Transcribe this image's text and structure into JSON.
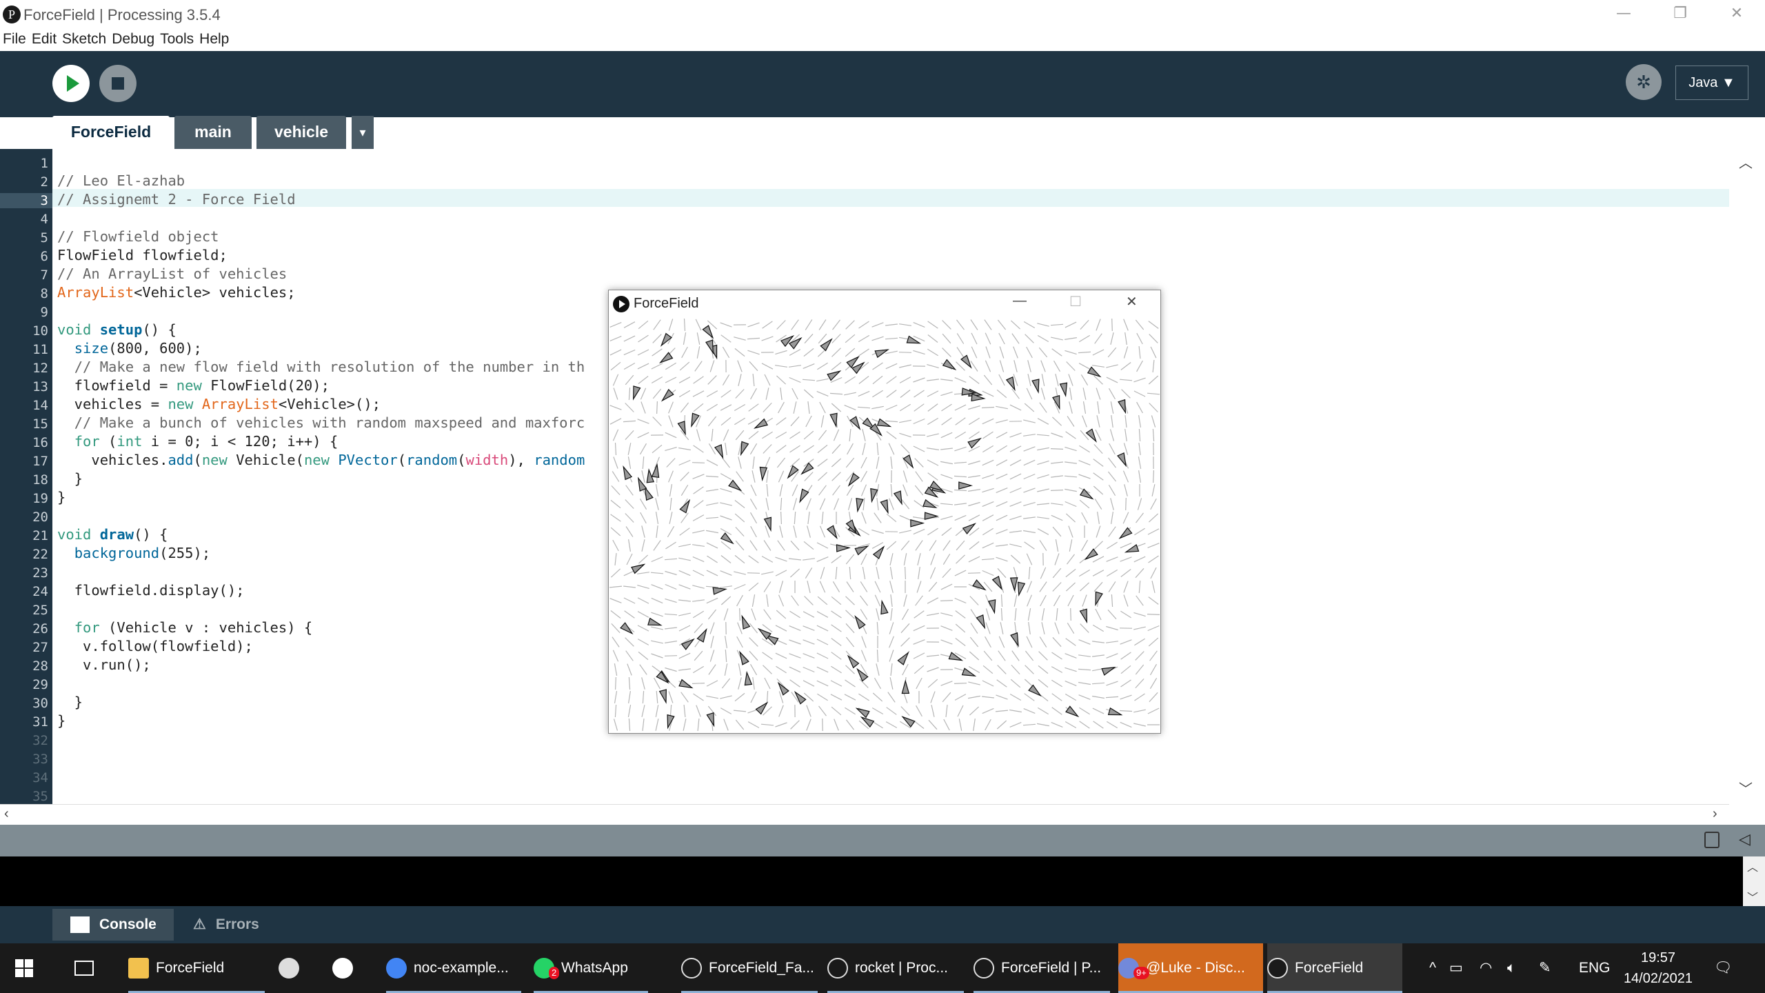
{
  "window": {
    "title": "ForceField | Processing 3.5.4",
    "minimize": "—",
    "restore": "❐",
    "close": "✕"
  },
  "menu": [
    "File",
    "Edit",
    "Sketch",
    "Debug",
    "Tools",
    "Help"
  ],
  "toolbar": {
    "mode": "Java ▼"
  },
  "tabs": [
    "ForceField",
    "main",
    "vehicle"
  ],
  "tabs_more": "▾",
  "editor": {
    "current_line": 3,
    "line_count": 35,
    "lines": [
      "",
      "// Leo El-azhab",
      "// Assignemt 2 - Force Field",
      "",
      "// Flowfield object",
      "FlowField flowfield;",
      "// An ArrayList of vehicles",
      "ArrayList<Vehicle> vehicles;",
      "",
      "void setup() {",
      "  size(800, 600);",
      "  // Make a new flow field with resolution of the number in th",
      "  flowfield = new FlowField(20);",
      "  vehicles = new ArrayList<Vehicle>();",
      "  // Make a bunch of vehicles with random maxspeed and maxforc",
      "  for (int i = 0; i < 120; i++) {",
      "    vehicles.add(new Vehicle(new PVector(random(width), random",
      "  }",
      "}",
      "",
      "void draw() {",
      "  background(255);",
      "",
      "  flowfield.display();",
      "",
      "  for (Vehicle v : vehicles) {",
      "   v.follow(flowfield);",
      "   v.run();",
      "",
      "  }",
      "}",
      "",
      "",
      "",
      ""
    ]
  },
  "console_tabs": {
    "console": "Console",
    "errors": "Errors"
  },
  "sketch_window": {
    "title": "ForceField",
    "minimize": "—",
    "maximize": "☐",
    "close": "✕"
  },
  "taskbar": {
    "items": [
      {
        "label": "ForceField",
        "icon": "folder-icon"
      },
      {
        "label": "",
        "icon": "slashes-app-icon"
      },
      {
        "label": "",
        "icon": "xbox-icon"
      },
      {
        "label": "noc-example...",
        "icon": "chrome-icon"
      },
      {
        "label": "WhatsApp",
        "icon": "whatsapp-icon",
        "badge": "2"
      },
      {
        "label": "ForceField_Fa...",
        "icon": "processing-icon"
      },
      {
        "label": "rocket | Proc...",
        "icon": "processing-icon"
      },
      {
        "label": "ForceField | P...",
        "icon": "processing-icon"
      },
      {
        "label": "@Luke - Disc...",
        "icon": "discord-icon",
        "badge": "9+"
      },
      {
        "label": "ForceField",
        "icon": "play-icon"
      }
    ],
    "tray": {
      "lang": "ENG",
      "time": "19:57",
      "date": "14/02/2021"
    }
  },
  "colors": {
    "toolbar": "#1f3443",
    "discord_active": "#d2691e",
    "run": "#1b9a3c"
  }
}
